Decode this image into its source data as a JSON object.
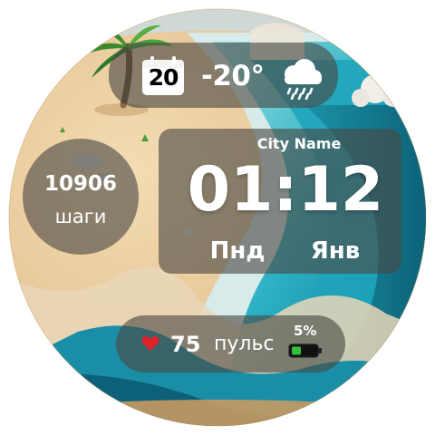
{
  "weather": {
    "date_day": "20",
    "temperature": "-20°",
    "icon": "rain-cloud-icon",
    "calendar_icon": "calendar-icon"
  },
  "steps": {
    "value": "10906",
    "label": "шаги"
  },
  "clock": {
    "city": "City Name",
    "time": "01:12",
    "weekday": "Пнд",
    "month": "Янв"
  },
  "status": {
    "heart_icon": "heart-icon",
    "heart_rate": "75",
    "heart_label": "пульс",
    "battery_percent": "5%",
    "battery_level": 0.05,
    "battery_icon": "battery-icon"
  },
  "colors": {
    "panel": "#4b4844",
    "text": "#ffffff",
    "heart": "#e0202a",
    "battery": "#2fc13a",
    "sea": "#2bb0c4",
    "sand": "#e6c595"
  }
}
